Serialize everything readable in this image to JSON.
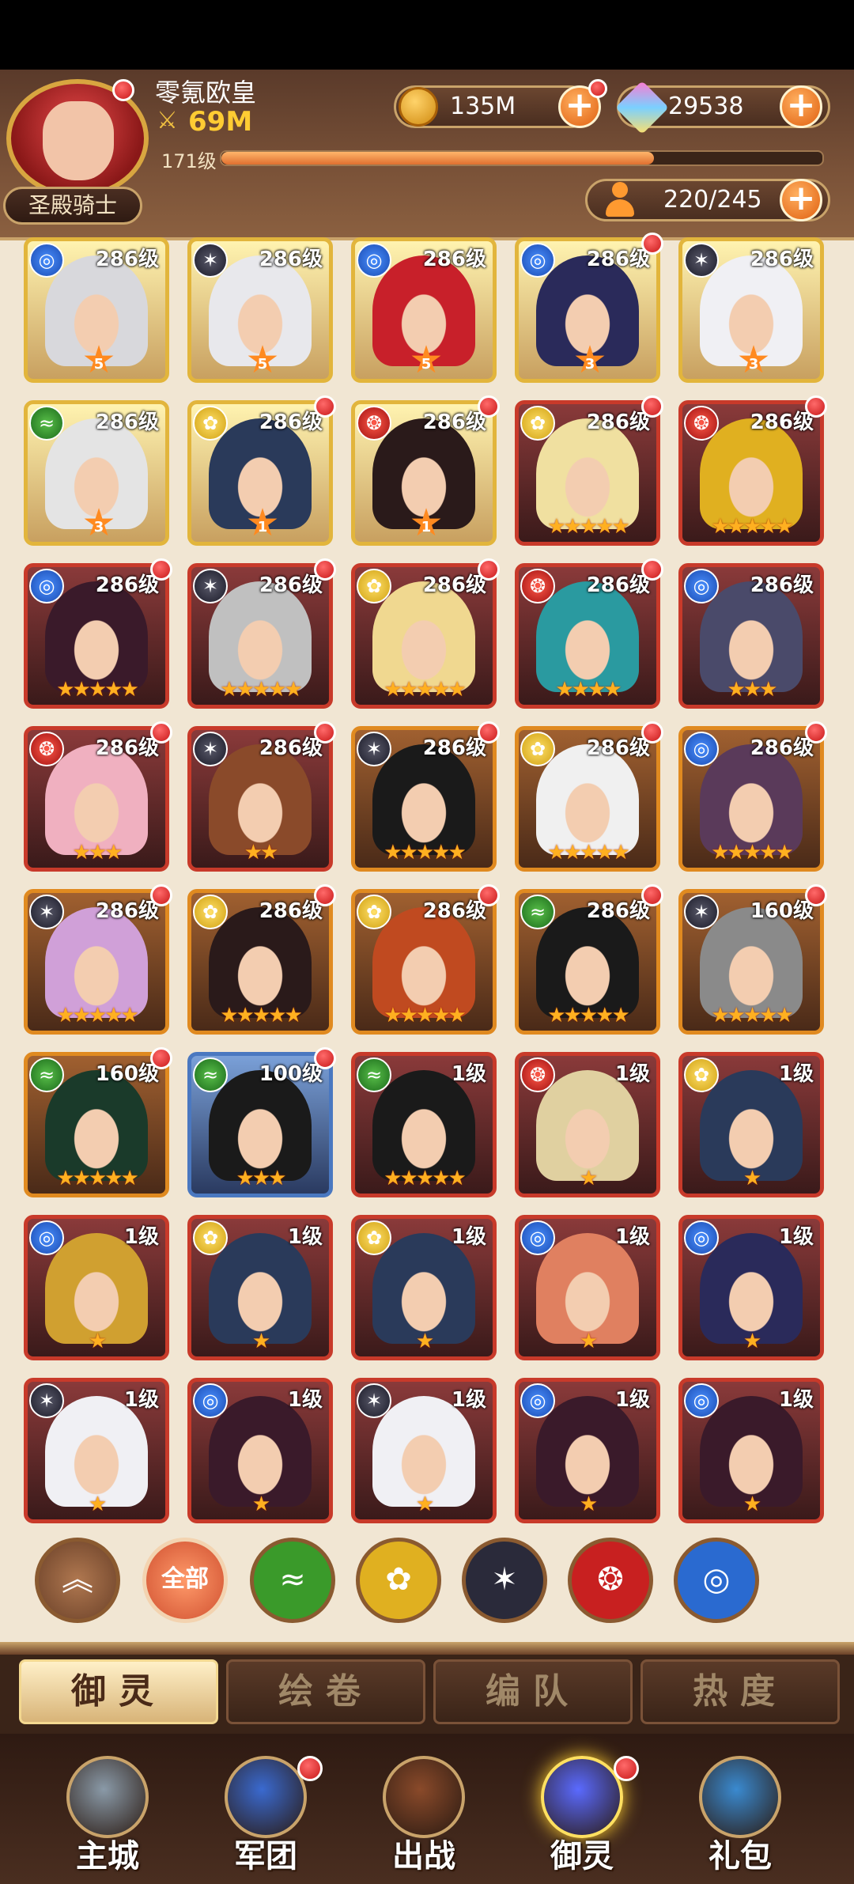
{
  "player": {
    "name": "零氪欧皇",
    "power": "69M",
    "level": "171级",
    "level_progress": 0.72,
    "title": "圣殿骑士"
  },
  "resources": {
    "gold": "135M",
    "crystals": "29538",
    "capacity": "220/245"
  },
  "heroes": [
    {
      "element": "water",
      "level": "286级",
      "frame": "gold",
      "rank": "5",
      "stars": 0,
      "dot": false,
      "hair": "#d8d8dc"
    },
    {
      "element": "dark",
      "level": "286级",
      "frame": "gold",
      "rank": "5",
      "stars": 0,
      "dot": false,
      "hair": "#e8e8ec"
    },
    {
      "element": "water",
      "level": "286级",
      "frame": "gold",
      "rank": "5",
      "stars": 0,
      "dot": false,
      "hair": "#c8202a"
    },
    {
      "element": "water",
      "level": "286级",
      "frame": "gold",
      "rank": "3",
      "stars": 0,
      "dot": true,
      "hair": "#2a2a5a"
    },
    {
      "element": "dark",
      "level": "286级",
      "frame": "gold",
      "rank": "3",
      "stars": 0,
      "dot": false,
      "hair": "#f0f0f4"
    },
    {
      "element": "wind",
      "level": "286级",
      "frame": "gold",
      "rank": "3",
      "stars": 0,
      "dot": false,
      "hair": "#e4e4e4"
    },
    {
      "element": "light",
      "level": "286级",
      "frame": "gold",
      "rank": "1",
      "stars": 0,
      "dot": true,
      "hair": "#2a3a5a"
    },
    {
      "element": "fire",
      "level": "286级",
      "frame": "gold",
      "rank": "1",
      "stars": 0,
      "dot": true,
      "hair": "#2a1a1a"
    },
    {
      "element": "light",
      "level": "286级",
      "frame": "red",
      "rank": "",
      "stars": 5,
      "dot": true,
      "hair": "#f0e0a0"
    },
    {
      "element": "fire",
      "level": "286级",
      "frame": "red",
      "rank": "",
      "stars": 5,
      "dot": true,
      "hair": "#e0b020"
    },
    {
      "element": "water",
      "level": "286级",
      "frame": "red",
      "rank": "",
      "stars": 5,
      "dot": true,
      "hair": "#3a1a2a"
    },
    {
      "element": "dark",
      "level": "286级",
      "frame": "red",
      "rank": "",
      "stars": 5,
      "dot": true,
      "hair": "#c0c0c0"
    },
    {
      "element": "light",
      "level": "286级",
      "frame": "red",
      "rank": "",
      "stars": 5,
      "dot": true,
      "hair": "#f0d890"
    },
    {
      "element": "fire",
      "level": "286级",
      "frame": "red",
      "rank": "",
      "stars": 4,
      "dot": true,
      "hair": "#2a9aa0"
    },
    {
      "element": "water",
      "level": "286级",
      "frame": "red",
      "rank": "",
      "stars": 3,
      "dot": false,
      "hair": "#4a4a6a"
    },
    {
      "element": "fire",
      "level": "286级",
      "frame": "red",
      "rank": "",
      "stars": 3,
      "dot": true,
      "hair": "#f0b0c0"
    },
    {
      "element": "dark",
      "level": "286级",
      "frame": "red",
      "rank": "",
      "stars": 2,
      "dot": true,
      "hair": "#8a4a2a"
    },
    {
      "element": "dark",
      "level": "286级",
      "frame": "orange",
      "rank": "",
      "stars": 5,
      "dot": true,
      "hair": "#1a1a1a"
    },
    {
      "element": "light",
      "level": "286级",
      "frame": "orange",
      "rank": "",
      "stars": 5,
      "dot": true,
      "hair": "#f0f0f0"
    },
    {
      "element": "water",
      "level": "286级",
      "frame": "orange",
      "rank": "",
      "stars": 5,
      "dot": true,
      "hair": "#5a3a5a"
    },
    {
      "element": "dark",
      "level": "286级",
      "frame": "orange",
      "rank": "",
      "stars": 5,
      "dot": true,
      "hair": "#d0a0d8"
    },
    {
      "element": "light",
      "level": "286级",
      "frame": "orange",
      "rank": "",
      "stars": 5,
      "dot": true,
      "hair": "#2a1a1a"
    },
    {
      "element": "light",
      "level": "286级",
      "frame": "orange",
      "rank": "",
      "stars": 5,
      "dot": true,
      "hair": "#c04a20"
    },
    {
      "element": "wind",
      "level": "286级",
      "frame": "orange",
      "rank": "",
      "stars": 5,
      "dot": true,
      "hair": "#1a1a1a"
    },
    {
      "element": "dark",
      "level": "160级",
      "frame": "orange",
      "rank": "",
      "stars": 5,
      "dot": true,
      "hair": "#8a8a8a"
    },
    {
      "element": "wind",
      "level": "160级",
      "frame": "orange",
      "rank": "",
      "stars": 5,
      "dot": true,
      "hair": "#1a3a2a"
    },
    {
      "element": "wind",
      "level": "100级",
      "frame": "blue",
      "rank": "",
      "stars": 3,
      "dot": true,
      "hair": "#1a1a1a"
    },
    {
      "element": "wind",
      "level": "1级",
      "frame": "red",
      "rank": "",
      "stars": 5,
      "dot": false,
      "hair": "#1a1a1a"
    },
    {
      "element": "fire",
      "level": "1级",
      "frame": "red",
      "rank": "",
      "stars": 1,
      "dot": false,
      "hair": "#e0d0a0"
    },
    {
      "element": "light",
      "level": "1级",
      "frame": "red",
      "rank": "",
      "stars": 1,
      "dot": false,
      "hair": "#2a3a5a"
    },
    {
      "element": "water",
      "level": "1级",
      "frame": "red",
      "rank": "",
      "stars": 1,
      "dot": false,
      "hair": "#d0a030"
    },
    {
      "element": "light",
      "level": "1级",
      "frame": "red",
      "rank": "",
      "stars": 1,
      "dot": false,
      "hair": "#2a3a5a"
    },
    {
      "element": "light",
      "level": "1级",
      "frame": "red",
      "rank": "",
      "stars": 1,
      "dot": false,
      "hair": "#2a3a5a"
    },
    {
      "element": "water",
      "level": "1级",
      "frame": "red",
      "rank": "",
      "stars": 1,
      "dot": false,
      "hair": "#e08060"
    },
    {
      "element": "water",
      "level": "1级",
      "frame": "red",
      "rank": "",
      "stars": 1,
      "dot": false,
      "hair": "#2a2a5a"
    },
    {
      "element": "dark",
      "level": "1级",
      "frame": "red",
      "rank": "",
      "stars": 1,
      "dot": false,
      "hair": "#f0f0f4"
    },
    {
      "element": "water",
      "level": "1级",
      "frame": "red",
      "rank": "",
      "stars": 1,
      "dot": false,
      "hair": "#3a1a2a"
    },
    {
      "element": "dark",
      "level": "1级",
      "frame": "red",
      "rank": "",
      "stars": 1,
      "dot": false,
      "hair": "#f0f0f4"
    },
    {
      "element": "water",
      "level": "1级",
      "frame": "red",
      "rank": "",
      "stars": 1,
      "dot": false,
      "hair": "#3a1a2a"
    },
    {
      "element": "water",
      "level": "1级",
      "frame": "red",
      "rank": "",
      "stars": 1,
      "dot": false,
      "hair": "#3a1a2a"
    }
  ],
  "filters": {
    "collapse_icon": "double-chevron-up-icon",
    "all_label": "全部",
    "elements": [
      {
        "name": "wind",
        "color": "#3a9a2a"
      },
      {
        "name": "light",
        "color": "#e0b020"
      },
      {
        "name": "dark",
        "color": "#2a2a3a"
      },
      {
        "name": "fire",
        "color": "#c82020"
      },
      {
        "name": "water",
        "color": "#2a6ad0"
      }
    ]
  },
  "subtabs": [
    "御灵",
    "绘卷",
    "编队",
    "热度"
  ],
  "nav": [
    {
      "label": "主城",
      "dot": false
    },
    {
      "label": "军团",
      "dot": true
    },
    {
      "label": "出战",
      "dot": false
    },
    {
      "label": "御灵",
      "dot": true
    },
    {
      "label": "礼包",
      "dot": false
    }
  ]
}
